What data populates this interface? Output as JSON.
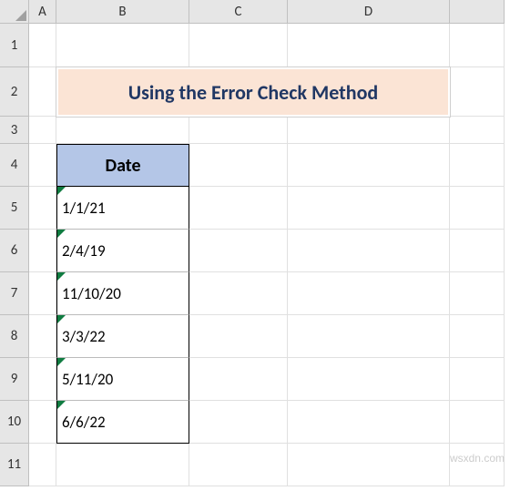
{
  "columns": [
    "A",
    "B",
    "C",
    "D",
    ""
  ],
  "rows": [
    "1",
    "2",
    "3",
    "4",
    "5",
    "6",
    "7",
    "8",
    "9",
    "10",
    "11"
  ],
  "title": "Using the Error Check Method",
  "table": {
    "header": "Date",
    "cells": [
      "1/1/21",
      "2/4/19",
      "11/10/20",
      "3/3/22",
      "5/11/20",
      "6/6/22"
    ]
  },
  "watermark": "wsxdn.com"
}
